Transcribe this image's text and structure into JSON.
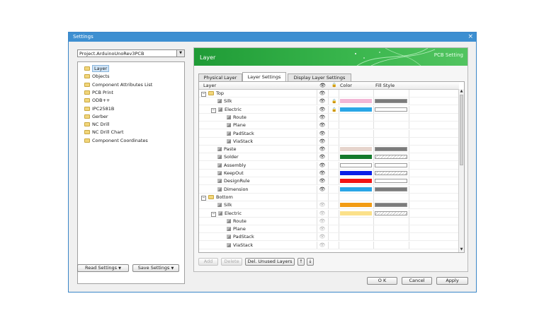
{
  "window": {
    "title": "Settings",
    "close_glyph": "×"
  },
  "left": {
    "project_value": "Project.ArduinoUnoRev3PCB",
    "tree": [
      "Layer",
      "Objects",
      "Component Attributes List",
      "PCB Print",
      "ODB++",
      "IPC2581B",
      "Gerber",
      "NC Drill",
      "NC Drill Chart",
      "Component Coordinates"
    ],
    "read_settings": "Read Settings",
    "save_settings": "Save Settings"
  },
  "panel": {
    "title": "Layer",
    "banner_right": "PCB Setting",
    "tabs": [
      "Physical Layer",
      "Layer Settings",
      "Display Layer Settings"
    ],
    "headers": {
      "layer": "Layer",
      "color": "Color",
      "fill": "Fill Style"
    }
  },
  "rows": [
    {
      "name": "Top",
      "level": 0,
      "kind": "folder",
      "expand": "−",
      "eye": "on",
      "lock": false,
      "color": null,
      "fill": null
    },
    {
      "name": "Silk",
      "level": 1,
      "kind": "layer",
      "expand": "",
      "eye": "on",
      "lock": true,
      "color": "#f2b7d6",
      "fill": "#7b7b7b"
    },
    {
      "name": "Electric",
      "level": 1,
      "kind": "layer",
      "expand": "−",
      "eye": "on",
      "lock": true,
      "color": "#2aa6e6",
      "fill": "#ffffff"
    },
    {
      "name": "Route",
      "level": 2,
      "kind": "layer",
      "expand": "",
      "eye": "on",
      "lock": false,
      "color": null,
      "fill": null
    },
    {
      "name": "Plane",
      "level": 2,
      "kind": "layer",
      "expand": "",
      "eye": "on",
      "lock": false,
      "color": null,
      "fill": null
    },
    {
      "name": "PadStack",
      "level": 2,
      "kind": "layer",
      "expand": "",
      "eye": "on",
      "lock": false,
      "color": null,
      "fill": null
    },
    {
      "name": "ViaStack",
      "level": 2,
      "kind": "layer",
      "expand": "",
      "eye": "on",
      "lock": false,
      "color": null,
      "fill": null
    },
    {
      "name": "Paste",
      "level": 1,
      "kind": "layer",
      "expand": "",
      "eye": "on",
      "lock": false,
      "color": "#e6d4cc",
      "fill": "#7b7b7b"
    },
    {
      "name": "Solder",
      "level": 1,
      "kind": "layer",
      "expand": "",
      "eye": "on",
      "lock": false,
      "color": "#147a2c",
      "fill": "hatch"
    },
    {
      "name": "Assembly",
      "level": 1,
      "kind": "layer",
      "expand": "",
      "eye": "on",
      "lock": false,
      "color": "#ffffff",
      "fill": "#ffffff"
    },
    {
      "name": "KeepOut",
      "level": 1,
      "kind": "layer",
      "expand": "",
      "eye": "on",
      "lock": false,
      "color": "#0a1ee6",
      "fill": "hatch"
    },
    {
      "name": "DesignRule",
      "level": 1,
      "kind": "layer",
      "expand": "",
      "eye": "on",
      "lock": false,
      "color": "#f21414",
      "fill": "#ffffff"
    },
    {
      "name": "Dimension",
      "level": 1,
      "kind": "layer",
      "expand": "",
      "eye": "on",
      "lock": false,
      "color": "#2aa6e6",
      "fill": "#7b7b7b"
    },
    {
      "name": "Bottom",
      "level": 0,
      "kind": "folder",
      "expand": "−",
      "eye": "none",
      "lock": false,
      "color": null,
      "fill": null
    },
    {
      "name": "Silk",
      "level": 1,
      "kind": "layer",
      "expand": "",
      "eye": "dim",
      "lock": false,
      "color": "#f29c14",
      "fill": "#7b7b7b"
    },
    {
      "name": "Electric",
      "level": 1,
      "kind": "layer",
      "expand": "−",
      "eye": "dim",
      "lock": false,
      "color": "#fbe18a",
      "fill": "hatch"
    },
    {
      "name": "Route",
      "level": 2,
      "kind": "layer",
      "expand": "",
      "eye": "dim",
      "lock": false,
      "color": null,
      "fill": null
    },
    {
      "name": "Plane",
      "level": 2,
      "kind": "layer",
      "expand": "",
      "eye": "dim",
      "lock": false,
      "color": null,
      "fill": null
    },
    {
      "name": "PadStack",
      "level": 2,
      "kind": "layer",
      "expand": "",
      "eye": "dim",
      "lock": false,
      "color": null,
      "fill": null
    },
    {
      "name": "ViaStack",
      "level": 2,
      "kind": "layer",
      "expand": "",
      "eye": "dim",
      "lock": false,
      "color": null,
      "fill": null
    }
  ],
  "toolbar": {
    "add": "Add",
    "delete": "Delete",
    "del_unused": "Del. Unused Layers",
    "up": "↑",
    "down": "↓"
  },
  "footer": {
    "ok": "O K",
    "cancel": "Cancel",
    "apply": "Apply"
  },
  "icons": {
    "eye": "👁",
    "lock": "🔒",
    "dropdown": "▼",
    "scroll_up": "▲",
    "scroll_down": "▼"
  }
}
